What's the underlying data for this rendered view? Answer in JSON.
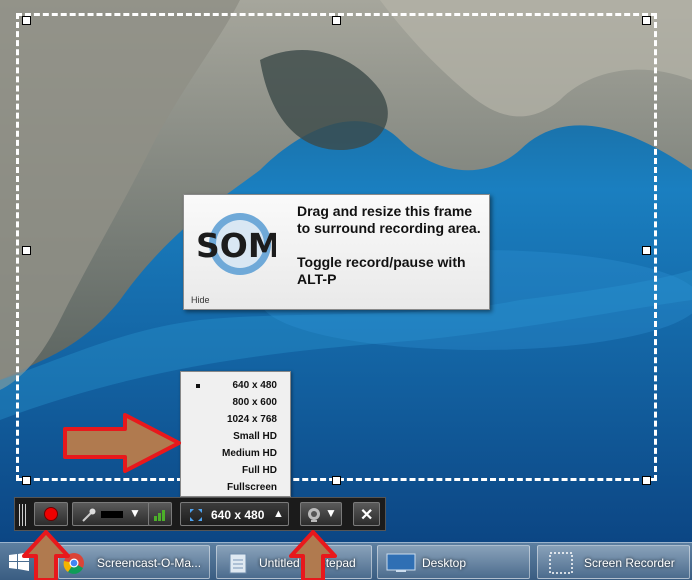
{
  "tooltip": {
    "logo_text": "SOM",
    "line1": "Drag and resize this frame to surround recording area.",
    "line2": "Toggle record/pause with ALT-P",
    "hide_label": "Hide"
  },
  "size_menu": {
    "items": [
      "640 x 480",
      "800 x 600",
      "1024 x 768",
      "Small HD",
      "Medium HD",
      "Full HD",
      "Fullscreen"
    ],
    "selected": "640 x 480"
  },
  "toolbar": {
    "size_value": "640 x 480",
    "size_arrow": "▲",
    "dropdown_arrow": "▼",
    "close_glyph": "✕"
  },
  "taskbar": {
    "items": [
      "Screencast-O-Ma...",
      "Untitled - Notepad",
      "Desktop",
      "Screen Recorder"
    ]
  },
  "colors": {
    "record": "#e00000",
    "arrow_red": "#e8181c",
    "level_green": "#4caf2a"
  }
}
